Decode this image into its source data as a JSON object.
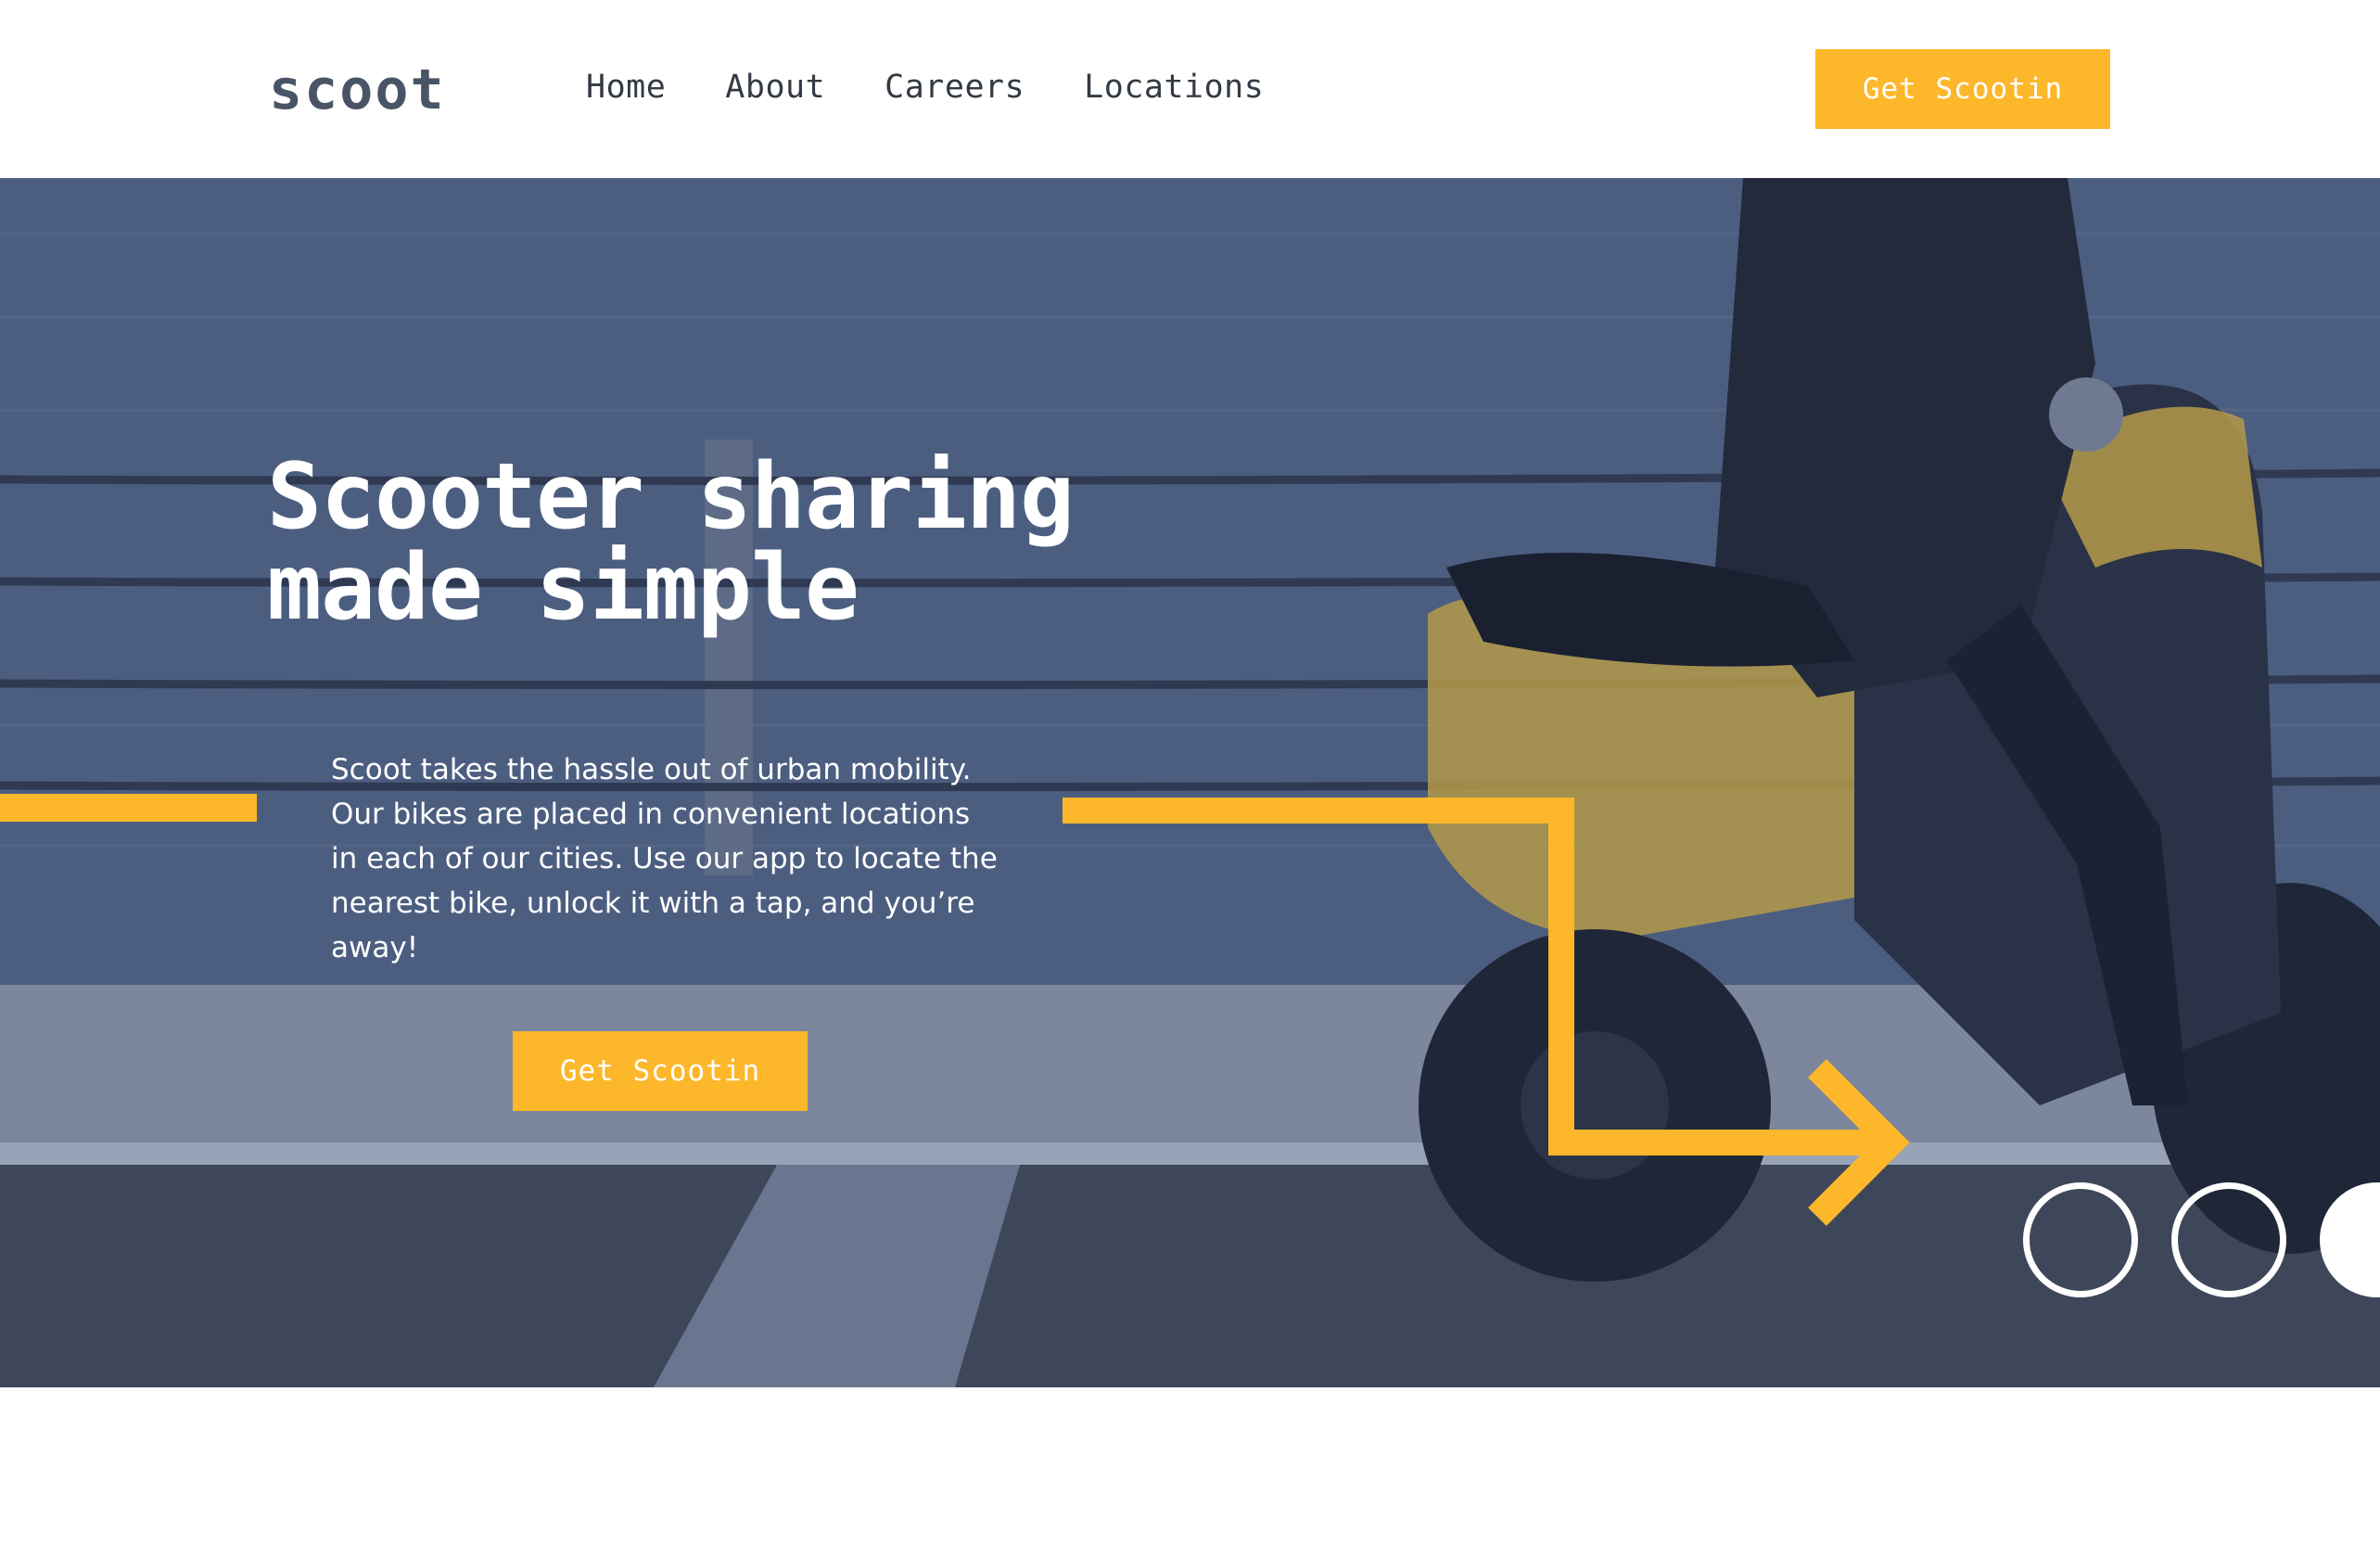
{
  "brand": {
    "logo": "scoot"
  },
  "nav": {
    "items": [
      {
        "label": "Home"
      },
      {
        "label": "About"
      },
      {
        "label": "Careers"
      },
      {
        "label": "Locations"
      }
    ]
  },
  "header": {
    "cta_label": "Get Scootin"
  },
  "hero": {
    "title_line_1": "Scooter sharing",
    "title_line_2": "made simple",
    "body": "Scoot takes the hassle out of urban mobility. Our bikes are placed in convenient locations in each of our cities. Use our app to locate the nearest bike, unlock it with a tap, and you’re away!",
    "cta_label": "Get Scootin",
    "background_image": "scooter-rider-photo"
  },
  "colors": {
    "accent": "#fcb72b",
    "logo": "#495567",
    "nav_text": "#333a44",
    "hero_overlay": "#3b4a66",
    "white": "#ffffff"
  }
}
